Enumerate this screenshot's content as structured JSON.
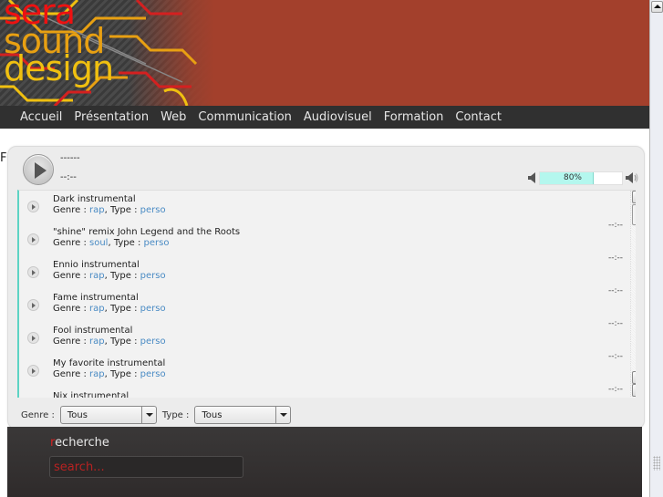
{
  "header": {
    "logo_lines": [
      "sera",
      "sound",
      "design"
    ]
  },
  "nav": {
    "items": [
      "Accueil",
      "Présentation",
      "Web",
      "Communication",
      "Audiovisuel",
      "Formation",
      "Contact"
    ]
  },
  "stray_text": "F",
  "player": {
    "track_title": "------",
    "track_time": "--:--",
    "volume": {
      "percent": 80,
      "label": "80%"
    },
    "playlist": [
      {
        "title": "Dark instrumental",
        "genre_label": "Genre : ",
        "genre": "rap",
        "type_label": ", Type : ",
        "type": "perso",
        "duration": "--:--"
      },
      {
        "title": "\"shine\" remix John Legend and the Roots",
        "genre_label": "Genre : ",
        "genre": "soul",
        "type_label": ", Type : ",
        "type": "perso",
        "duration": "--:--"
      },
      {
        "title": "Ennio instrumental",
        "genre_label": "Genre : ",
        "genre": "rap",
        "type_label": ", Type : ",
        "type": "perso",
        "duration": "--:--"
      },
      {
        "title": "Fame instrumental",
        "genre_label": "Genre : ",
        "genre": "rap",
        "type_label": ", Type : ",
        "type": "perso",
        "duration": "--:--"
      },
      {
        "title": "Fool instrumental",
        "genre_label": "Genre : ",
        "genre": "rap",
        "type_label": ", Type : ",
        "type": "perso",
        "duration": "--:--"
      },
      {
        "title": "My favorite instrumental",
        "genre_label": "Genre : ",
        "genre": "rap",
        "type_label": ", Type : ",
        "type": "perso",
        "duration": "--:--"
      },
      {
        "title": "Nix instrumental",
        "genre_label": "",
        "genre": "",
        "type_label": "",
        "type": "",
        "duration": "--:--"
      }
    ],
    "filters": {
      "genre_label": "Genre :",
      "genre_value": "Tous",
      "type_label": "Type :",
      "type_value": "Tous"
    }
  },
  "search": {
    "label_first": "r",
    "label_rest": "echerche",
    "placeholder": "search..."
  },
  "colors": {
    "header_bg": "#a3402c",
    "nav_bg": "#303030",
    "accent_teal": "#5dd3c4",
    "link_blue": "#4a8bc4",
    "search_red": "#c02424"
  }
}
